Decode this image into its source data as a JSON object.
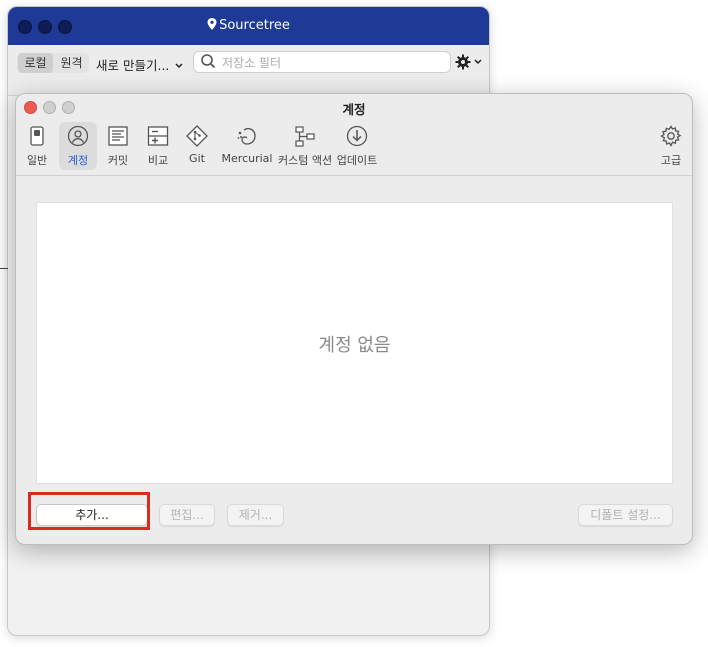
{
  "app": {
    "title": "Sourcetree",
    "title_bar_color": "#1e3a96",
    "tabs": {
      "local": "로컬",
      "remote": "원격"
    },
    "new_button": "새로 만들기...",
    "search_placeholder": "저장소 필터"
  },
  "prefs": {
    "title": "계정",
    "tabs": [
      {
        "label": "일반",
        "icon": "switch-icon"
      },
      {
        "label": "계정",
        "icon": "account-icon"
      },
      {
        "label": "커밋",
        "icon": "commit-icon"
      },
      {
        "label": "비교",
        "icon": "diff-icon"
      },
      {
        "label": "Git",
        "icon": "git-icon"
      },
      {
        "label": "Mercurial",
        "icon": "mercurial-icon"
      },
      {
        "label": "커스텀 액션",
        "icon": "custom-action-icon"
      },
      {
        "label": "업데이트",
        "icon": "update-icon"
      },
      {
        "label": "고급",
        "icon": "gear-icon"
      }
    ],
    "active_tab": "계정",
    "empty_text": "계정 없음",
    "buttons": {
      "add": "추가...",
      "edit": "편집...",
      "remove": "제거...",
      "default": "디폴트 설정..."
    },
    "highlight_color": "#d92b1f"
  }
}
